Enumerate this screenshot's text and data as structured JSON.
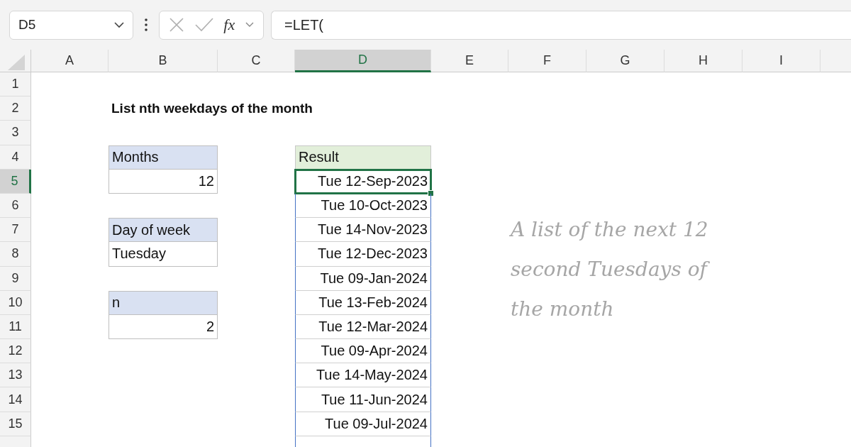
{
  "formula_bar": {
    "name_box": "D5",
    "function_label": "fx",
    "formula": "=LET("
  },
  "columns": [
    {
      "label": "A",
      "selected": false
    },
    {
      "label": "B",
      "selected": false
    },
    {
      "label": "C",
      "selected": false
    },
    {
      "label": "D",
      "selected": true
    },
    {
      "label": "E",
      "selected": false
    },
    {
      "label": "F",
      "selected": false
    },
    {
      "label": "G",
      "selected": false
    },
    {
      "label": "H",
      "selected": false
    },
    {
      "label": "I",
      "selected": false
    }
  ],
  "rows": [
    {
      "number": "1",
      "selected": false,
      "cells": {}
    },
    {
      "number": "2",
      "selected": false,
      "cells": {
        "B": {
          "kind": "title",
          "text": "List nth weekdays of the month"
        }
      }
    },
    {
      "number": "3",
      "selected": false,
      "cells": {}
    },
    {
      "number": "4",
      "selected": false,
      "cells": {
        "B": {
          "kind": "label",
          "text": "Months"
        },
        "D": {
          "kind": "result_header",
          "text": "Result"
        }
      }
    },
    {
      "number": "5",
      "selected": true,
      "cells": {
        "B": {
          "kind": "number",
          "text": "12"
        },
        "D": {
          "kind": "result",
          "text": "Tue 12-Sep-2023",
          "selected": true
        }
      }
    },
    {
      "number": "6",
      "selected": false,
      "cells": {
        "D": {
          "kind": "result",
          "text": "Tue 10-Oct-2023",
          "selected": false
        }
      }
    },
    {
      "number": "7",
      "selected": false,
      "cells": {
        "B": {
          "kind": "label",
          "text": "Day of week"
        },
        "D": {
          "kind": "result",
          "text": "Tue 14-Nov-2023",
          "selected": false
        }
      }
    },
    {
      "number": "8",
      "selected": false,
      "cells": {
        "B": {
          "kind": "value",
          "text": "Tuesday"
        },
        "D": {
          "kind": "result",
          "text": "Tue 12-Dec-2023",
          "selected": false
        }
      }
    },
    {
      "number": "9",
      "selected": false,
      "cells": {
        "D": {
          "kind": "result",
          "text": "Tue 09-Jan-2024",
          "selected": false
        }
      }
    },
    {
      "number": "10",
      "selected": false,
      "cells": {
        "B": {
          "kind": "label",
          "text": "n"
        },
        "D": {
          "kind": "result",
          "text": "Tue 13-Feb-2024",
          "selected": false
        }
      }
    },
    {
      "number": "11",
      "selected": false,
      "cells": {
        "B": {
          "kind": "number",
          "text": "2"
        },
        "D": {
          "kind": "result",
          "text": "Tue 12-Mar-2024",
          "selected": false
        }
      }
    },
    {
      "number": "12",
      "selected": false,
      "cells": {
        "D": {
          "kind": "result",
          "text": "Tue 09-Apr-2024",
          "selected": false
        }
      }
    },
    {
      "number": "13",
      "selected": false,
      "cells": {
        "D": {
          "kind": "result",
          "text": "Tue 14-May-2024",
          "selected": false
        }
      }
    },
    {
      "number": "14",
      "selected": false,
      "cells": {
        "D": {
          "kind": "result",
          "text": "Tue 11-Jun-2024",
          "selected": false
        }
      }
    },
    {
      "number": "15",
      "selected": false,
      "cells": {
        "D": {
          "kind": "result",
          "text": "Tue 09-Jul-2024",
          "selected": false
        }
      }
    }
  ],
  "note": {
    "lines": [
      "A list of the next 12",
      "second Tuesdays of",
      "the month"
    ]
  }
}
